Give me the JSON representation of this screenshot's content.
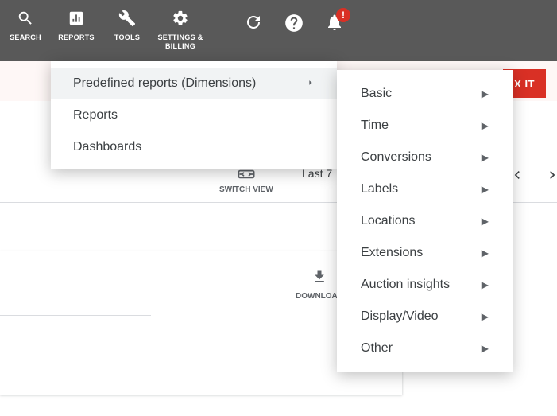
{
  "toolbar": {
    "search_label": "SEARCH",
    "reports_label": "REPORTS",
    "tools_label": "TOOLS",
    "settings_label": "SETTINGS &\nBILLING",
    "alert_badge": "!"
  },
  "notif": {
    "fixit_label": "X IT"
  },
  "menu": {
    "predefined_label": "Predefined reports (Dimensions)",
    "reports_label": "Reports",
    "dashboards_label": "Dashboards"
  },
  "submenu": {
    "items": [
      {
        "label": "Basic"
      },
      {
        "label": "Time"
      },
      {
        "label": "Conversions"
      },
      {
        "label": "Labels"
      },
      {
        "label": "Locations"
      },
      {
        "label": "Extensions"
      },
      {
        "label": "Auction insights"
      },
      {
        "label": "Display/Video"
      },
      {
        "label": "Other"
      }
    ]
  },
  "background": {
    "switch_view_label": "SWITCH VIEW",
    "date_range_label": "Last 7",
    "download_label": "DOWNLOAD"
  }
}
